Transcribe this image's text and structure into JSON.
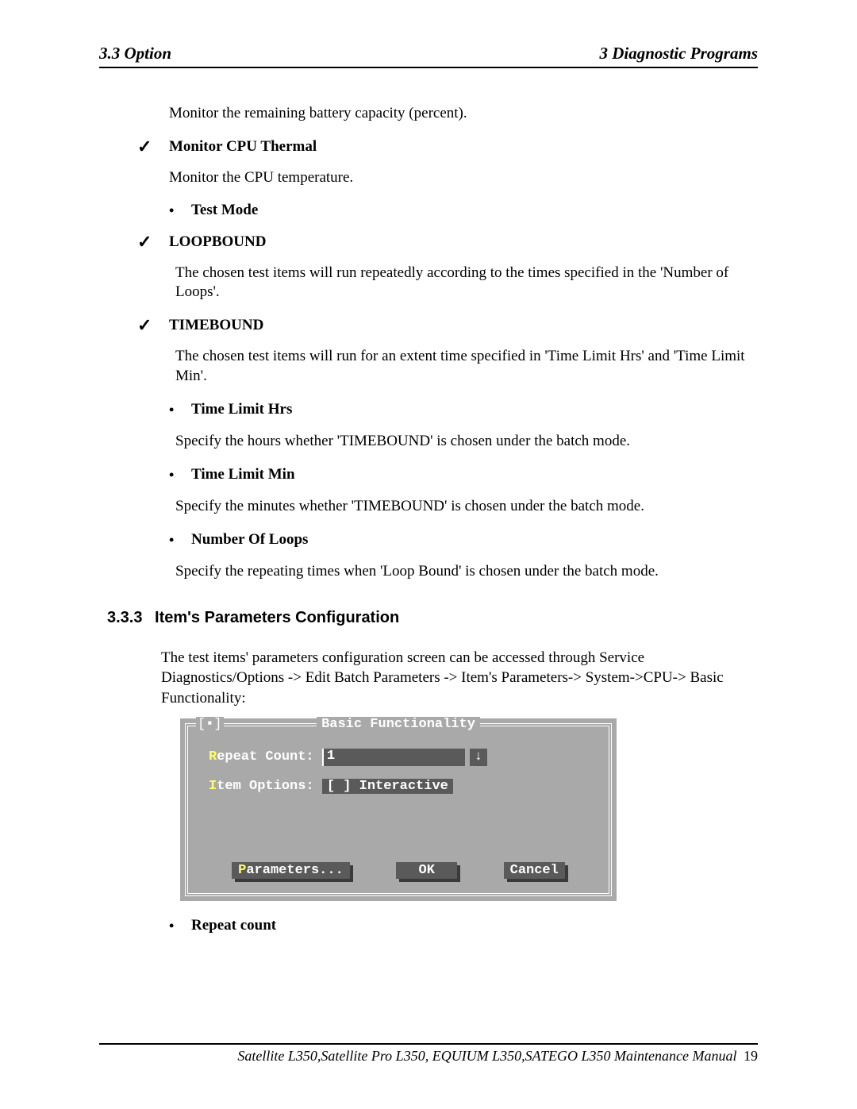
{
  "header": {
    "left": "3.3 Option",
    "right": "3  Diagnostic Programs"
  },
  "body": {
    "intro_line": "Monitor the remaining battery capacity (percent).",
    "cpu_thermal": {
      "title": "Monitor CPU Thermal",
      "desc": "Monitor the CPU temperature."
    },
    "test_mode": "Test Mode",
    "loopbound": {
      "title": "LOOPBOUND",
      "desc": "The chosen test items will run repeatedly according to the times specified in the 'Number of Loops'."
    },
    "timebound": {
      "title": "TIMEBOUND",
      "desc": "The chosen test items will run for an extent time specified in 'Time Limit Hrs' and 'Time Limit Min'."
    },
    "time_hrs": {
      "title": "Time Limit Hrs",
      "desc": "Specify the hours whether 'TIMEBOUND' is chosen under the batch mode."
    },
    "time_min": {
      "title": "Time Limit Min",
      "desc": "Specify the minutes whether 'TIMEBOUND' is chosen under the batch mode."
    },
    "num_loops": {
      "title": "Number Of Loops",
      "desc": "Specify the repeating times when 'Loop Bound' is chosen under the batch mode."
    }
  },
  "section": {
    "number": "3.3.3",
    "title": "Item's Parameters Configuration",
    "para": "The test items' parameters configuration screen can be accessed through Service Diagnostics/Options -> Edit Batch Parameters -> Item's Parameters-> System->CPU-> Basic Functionality:"
  },
  "dialog": {
    "title": "Basic Functionality",
    "close": "[▪]",
    "repeat_label_hl": "R",
    "repeat_label_rest": "epeat Count:",
    "repeat_value": "1",
    "arrow": "↓",
    "item_label_hl": "I",
    "item_label_rest": "tem Options:",
    "item_check": "[ ] Interactive",
    "btn_param_hl": "P",
    "btn_param_rest": "arameters...",
    "btn_ok": "  OK  ",
    "btn_cancel": "Cancel"
  },
  "trailing_bullet": "Repeat count",
  "footer": {
    "text": "Satellite L350,Satellite Pro L350, EQUIUM L350,SATEGO L350 Maintenance Manual",
    "page": "19"
  }
}
